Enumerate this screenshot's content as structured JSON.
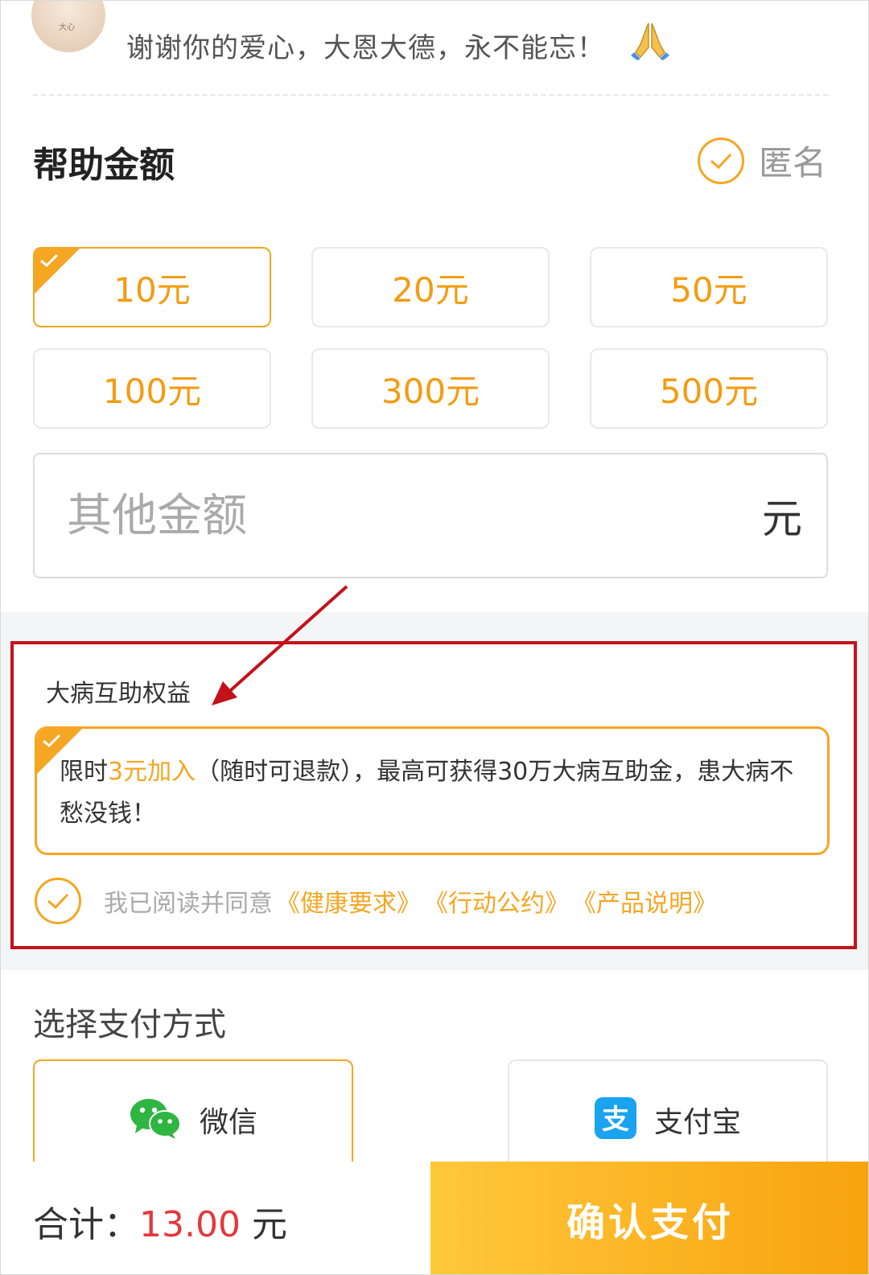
{
  "header": {
    "thanks_text": "谢谢你的爱心，大恩大德，永不能忘！",
    "avatar_text": "大心"
  },
  "amount_section": {
    "title": "帮助金额",
    "anonymous_label": "匿名",
    "anonymous_checked": true,
    "options": [
      {
        "label": "10元",
        "selected": true
      },
      {
        "label": "20元",
        "selected": false
      },
      {
        "label": "50元",
        "selected": false
      },
      {
        "label": "100元",
        "selected": false
      },
      {
        "label": "300元",
        "selected": false
      },
      {
        "label": "500元",
        "selected": false
      }
    ],
    "other_placeholder": "其他金额",
    "other_unit": "元"
  },
  "benefit_section": {
    "title": "大病互助权益",
    "card_prefix": "限时",
    "card_highlight": "3元加入",
    "card_rest": "（随时可退款），最高可获得30万大病互助金，患大病不愁没钱！",
    "agree_label": "我已阅读并同意",
    "links": [
      "《健康要求》",
      "《行动公约》",
      "《产品说明》"
    ],
    "agree_checked": true
  },
  "payment_section": {
    "title": "选择支付方式",
    "options": [
      {
        "label": "微信",
        "icon": "wechat-icon",
        "selected": true
      },
      {
        "label": "支付宝",
        "icon": "alipay-icon",
        "selected": false
      }
    ]
  },
  "footer": {
    "total_label": "合计：",
    "total_value": "13.00",
    "total_unit": "元",
    "confirm_label": "确认支付"
  },
  "colors": {
    "accent": "#f5a623",
    "price": "#e5383b",
    "annotation": "#c4121a",
    "wechat": "#2fb541",
    "alipay": "#1aa3ee"
  }
}
